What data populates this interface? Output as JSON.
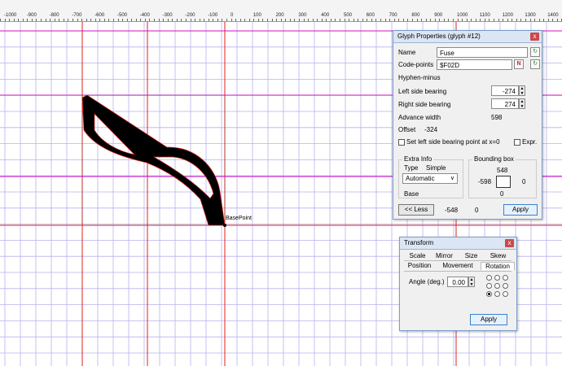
{
  "ruler": {
    "ticks": [
      "-1000",
      "-900",
      "-800",
      "-700",
      "-600",
      "-500",
      "-400",
      "-300",
      "-200",
      "-100",
      "0",
      "100",
      "200",
      "300",
      "400",
      "500",
      "600",
      "700",
      "800",
      "900",
      "1000",
      "1100",
      "1200",
      "1300",
      "1400"
    ]
  },
  "canvas": {
    "basepoint_label": "BasePoint",
    "colors": {
      "grid": "#b9b0ee",
      "metric_red": "#e0201b",
      "metric_magenta": "#d010c8",
      "glyph": "#000000"
    }
  },
  "glyph_props": {
    "title": "Glyph Properties (glyph #12)",
    "close": "x",
    "name_label": "Name",
    "name_value": "Fuse",
    "codepoints_label": "Code-points",
    "codepoints_value": "$F02D",
    "unicode_name": "Hyphen-minus",
    "lsb_label": "Left side bearing",
    "lsb_value": "-274",
    "rsb_label": "Right side bearing",
    "rsb_value": "274",
    "advance_label": "Advance width",
    "advance_value": "598",
    "offset_label": "Offset",
    "offset_value": "-324",
    "set_lsb_label": "Set left side bearing point at x=0",
    "expr_label": "Expr.",
    "extra_info_title": "Extra Info",
    "type_label": "Type",
    "type_value": "Simple",
    "combo_value": "Automatic",
    "base_label": "Base",
    "bbox_title": "Bounding box",
    "bbox_top": "548",
    "bbox_left": "-598",
    "bbox_right": "0",
    "bbox_bottom": "0",
    "less_button": "<< Less",
    "footer_val1": "-548",
    "footer_val2": "0",
    "apply_button": "Apply"
  },
  "transform": {
    "title": "Transform",
    "close": "x",
    "tabs_row1": [
      "Scale",
      "Mirror",
      "Size",
      "Skew"
    ],
    "tabs_row2": [
      "Position",
      "Movement",
      "Rotation"
    ],
    "angle_label": "Angle (deg.)",
    "angle_value": "0.00",
    "apply_button": "Apply"
  }
}
